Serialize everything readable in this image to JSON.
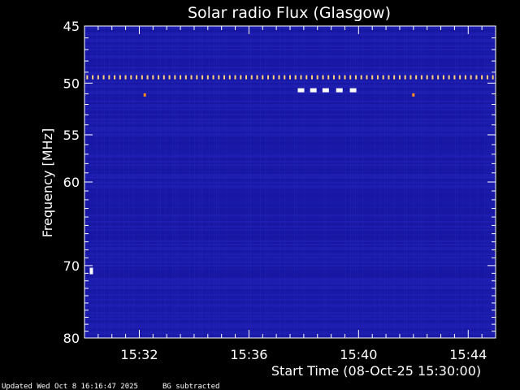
{
  "chart_data": {
    "type": "heatmap",
    "title": "Solar radio Flux (Glasgow)",
    "xlabel": "Start Time (08-Oct-25 15:30:00)",
    "ylabel": "Frequency [MHz]",
    "x_ticks": [
      "15:32",
      "15:36",
      "15:40",
      "15:44"
    ],
    "x_tick_minutes": [
      2,
      6,
      10,
      14
    ],
    "x_range_minutes": [
      0,
      15
    ],
    "y_ticks": [
      45,
      50,
      55,
      60,
      70,
      80
    ],
    "y_range": [
      45,
      80
    ],
    "y_scale": "log",
    "background_color": "#1a1aa8",
    "hot_colors": [
      "#ffffff",
      "#ffd27a",
      "#ff8c1a"
    ],
    "features": [
      {
        "name": "interference band",
        "freq_mhz": 49.5,
        "pattern": "periodic dashes across full time range"
      },
      {
        "name": "bright burst 1",
        "minute": 7.9,
        "freq_mhz": 50.7
      },
      {
        "name": "bright burst 2",
        "minute": 8.35,
        "freq_mhz": 50.7
      },
      {
        "name": "bright burst 3",
        "minute": 8.8,
        "freq_mhz": 50.7
      },
      {
        "name": "bright burst 4",
        "minute": 9.3,
        "freq_mhz": 50.7
      },
      {
        "name": "bright burst 5",
        "minute": 9.8,
        "freq_mhz": 50.7
      },
      {
        "name": "orange spot 1",
        "minute": 2.2,
        "freq_mhz": 51.1
      },
      {
        "name": "orange spot 2",
        "minute": 12.0,
        "freq_mhz": 51.1
      },
      {
        "name": "white spot",
        "minute": 0.25,
        "freq_mhz": 70.7
      }
    ]
  },
  "footer": {
    "updated": "Updated Wed Oct  8 16:16:47 2025",
    "note": "BG subtracted"
  }
}
